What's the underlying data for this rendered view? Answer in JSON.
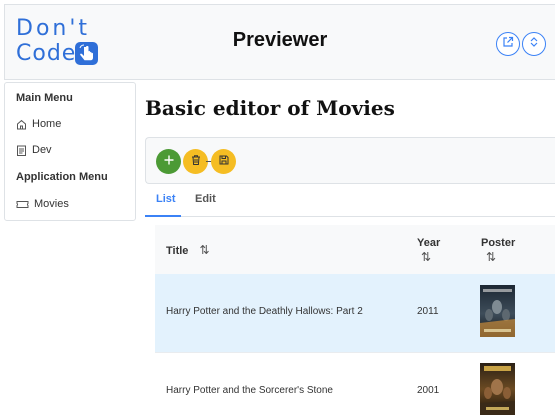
{
  "header": {
    "logo_line1": "Don't",
    "logo_line2": "Code",
    "title": "Previewer",
    "buttons": [
      {
        "icon": "external-link-icon"
      },
      {
        "icon": "sort-arrows-icon"
      }
    ]
  },
  "sidebar": {
    "main_menu_heading": "Main Menu",
    "main_items": [
      {
        "label": "Home",
        "icon": "home-icon"
      },
      {
        "label": "Dev",
        "icon": "document-icon"
      }
    ],
    "app_menu_heading": "Application Menu",
    "app_items": [
      {
        "label": "Movies",
        "icon": "ticket-icon"
      }
    ]
  },
  "main": {
    "title": "Basic editor of Movies",
    "toolbar": [
      {
        "action": "add",
        "icon": "plus-icon",
        "color": "#4c9a35"
      },
      {
        "action": "delete",
        "icon": "trash-icon",
        "color": "#f5bd23"
      },
      {
        "action": "save",
        "icon": "save-icon",
        "color": "#f5bd23"
      }
    ],
    "tabs": [
      {
        "label": "List",
        "active": true
      },
      {
        "label": "Edit",
        "active": false
      }
    ]
  },
  "table": {
    "columns": [
      {
        "label": "Title",
        "sort_icon": "⇅"
      },
      {
        "label": "Year",
        "sort_icon": "⇅"
      },
      {
        "label": "Poster",
        "sort_icon": "⇅"
      }
    ],
    "rows": [
      {
        "title": "Harry Potter and the Deathly Hallows: Part 2",
        "year": "2011",
        "selected": true
      },
      {
        "title": "Harry Potter and the Sorcerer's Stone",
        "year": "2001",
        "selected": false
      }
    ]
  },
  "colors": {
    "accent": "#3b82f6",
    "add_button": "#4c9a35",
    "warning_button": "#f5bd23",
    "selected_row": "#e3f2fd"
  }
}
